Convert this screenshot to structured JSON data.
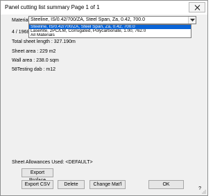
{
  "window": {
    "title": "Panel cutting list summary Page 1 of 1"
  },
  "material": {
    "label": "Material",
    "selected": "Steeline, IS/0.42/700/ZA, Steel Span, Za, 0.42, 700.0",
    "options": [
      "Steeline, IS/0.42/700/ZA, Steel Span, Za, 0.42, 700.0",
      "Laserlite, 2PC/LM, Corrugated, Polycarbonate, 1.00, 762.0",
      "All Materials"
    ]
  },
  "partial_text": "4 / 19680",
  "stats": {
    "total_sheet_length": "Total sheet length : 327.190m",
    "sheet_area": "Sheet area : 229 m2",
    "wall_area": "Wall area : 238.0 sqm",
    "testing": "58Testing dab : m12"
  },
  "allowances": "Sheet Allowances Used: <DEFAULT>",
  "buttons": {
    "export_proface": "Export Proface",
    "export_csv": "Export CSV",
    "delete": "Delete",
    "change_mat": "Change Mat'l",
    "ok": "OK"
  },
  "help_mark": "?"
}
